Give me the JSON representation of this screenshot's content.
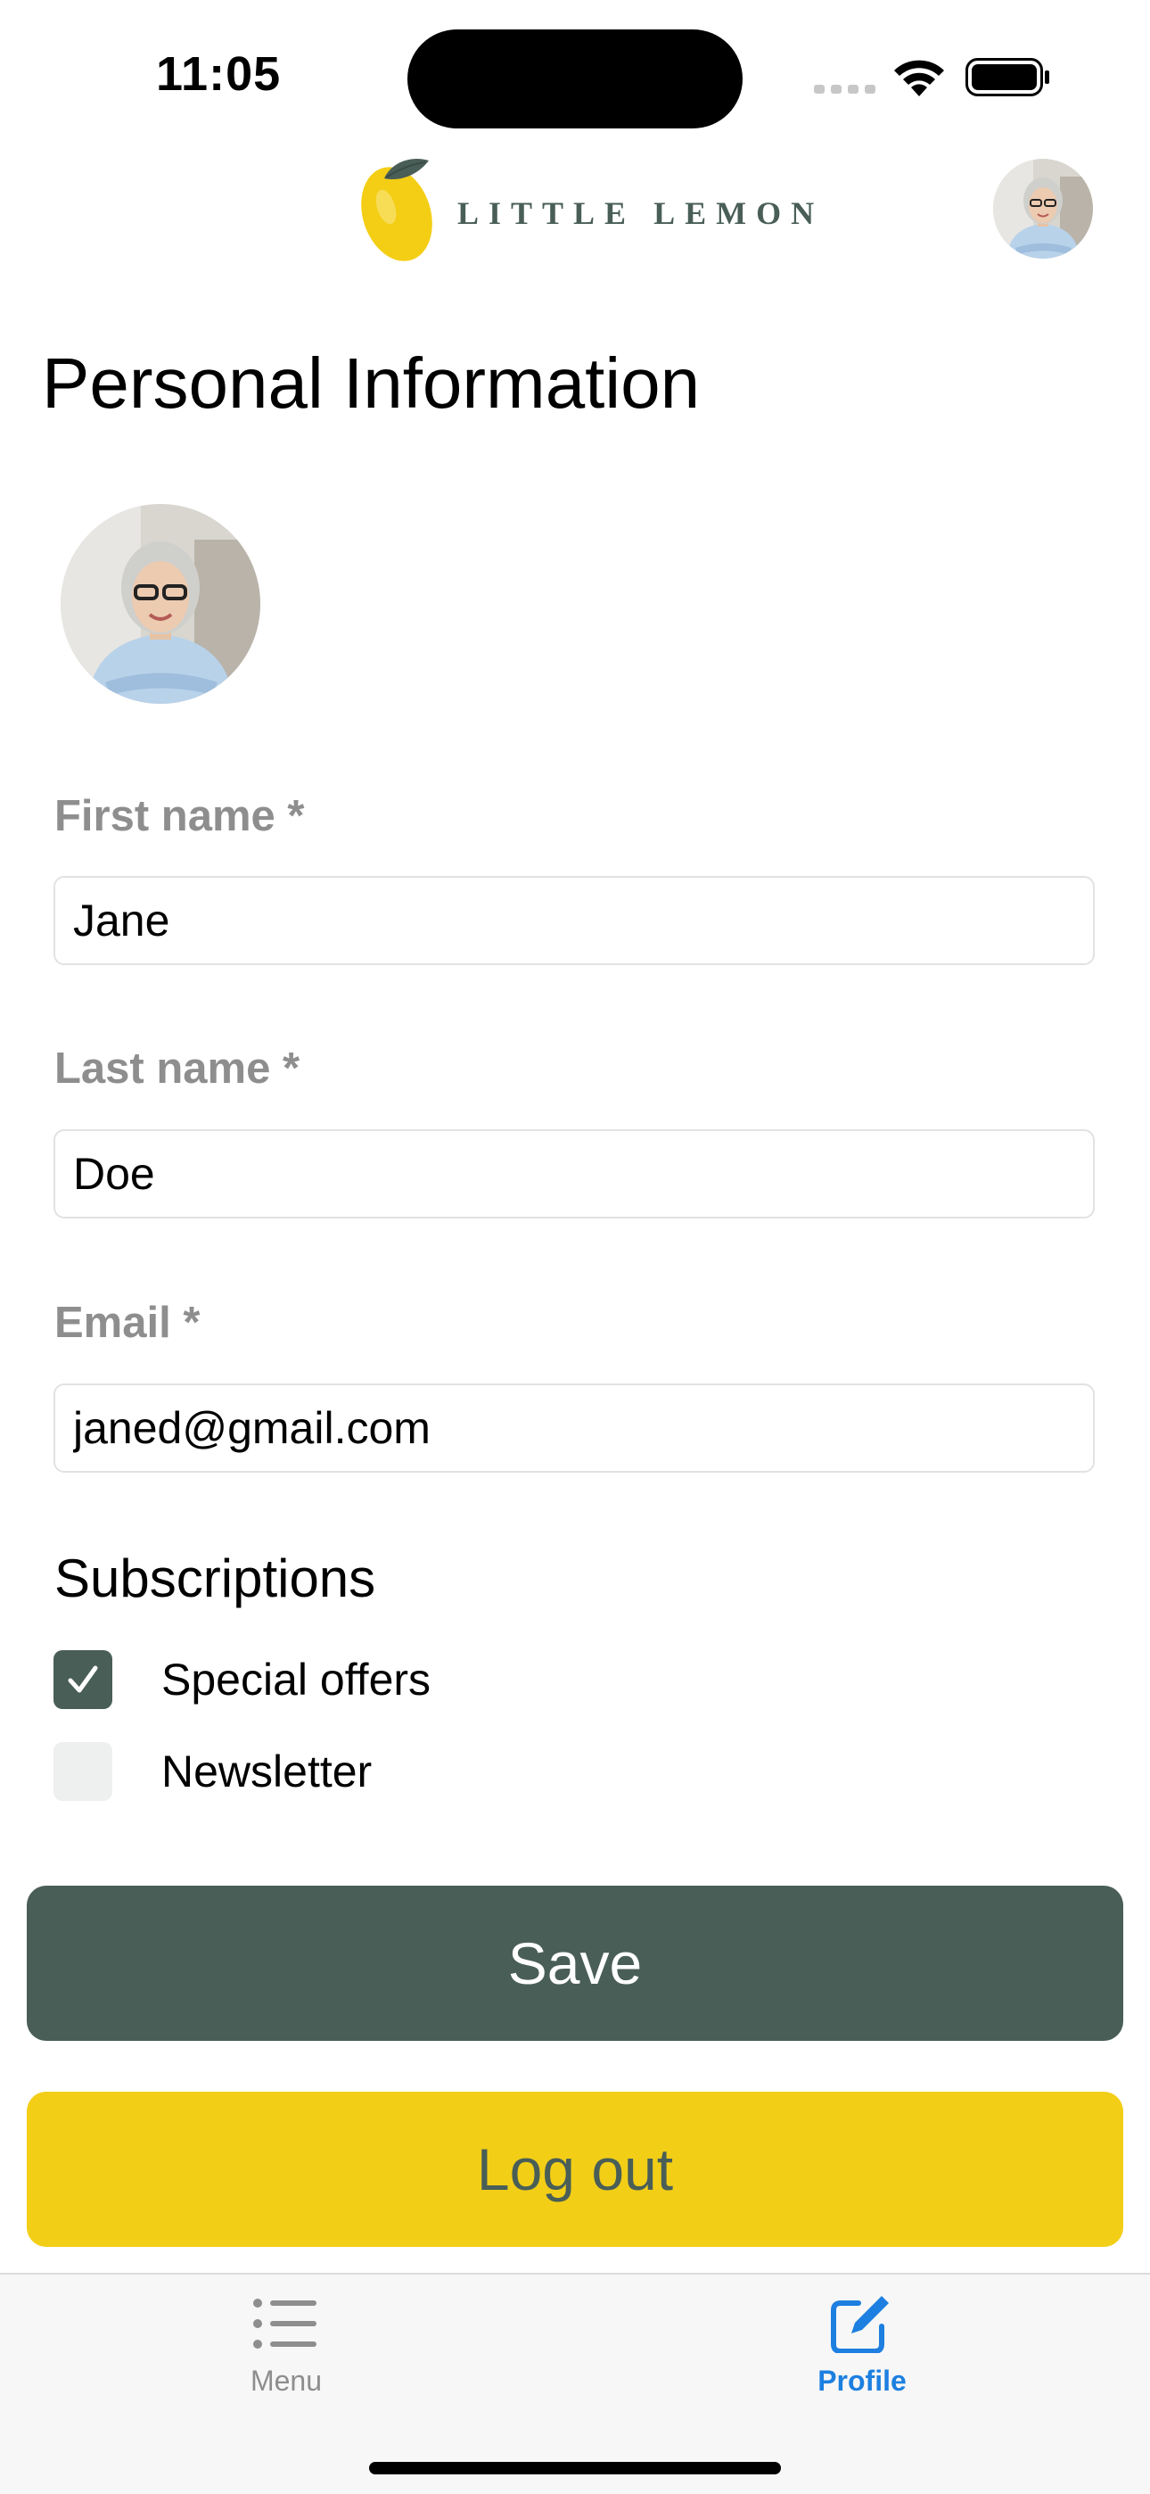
{
  "status_bar": {
    "time": "11:05"
  },
  "header": {
    "logo_text": "LITTLE LEMON"
  },
  "page": {
    "title": "Personal Information"
  },
  "form": {
    "first_name": {
      "label": "First name *",
      "value": "Jane"
    },
    "last_name": {
      "label": "Last name *",
      "value": "Doe"
    },
    "email": {
      "label": "Email *",
      "value": "janed@gmail.com"
    }
  },
  "subscriptions": {
    "title": "Subscriptions",
    "items": [
      {
        "label": "Special offers",
        "checked": true
      },
      {
        "label": "Newsletter",
        "checked": false
      }
    ]
  },
  "buttons": {
    "save": "Save",
    "logout": "Log out"
  },
  "tab_bar": {
    "tabs": [
      {
        "label": "Menu",
        "icon": "list-icon",
        "selected": false
      },
      {
        "label": "Profile",
        "icon": "square-pencil-icon",
        "selected": true
      }
    ]
  },
  "colors": {
    "primary_green": "#495E57",
    "primary_yellow": "#F2CE17",
    "tab_selected": "#1D7FE0",
    "tab_unselected": "#8E8E8E",
    "label_gray": "#8E8E8E"
  }
}
